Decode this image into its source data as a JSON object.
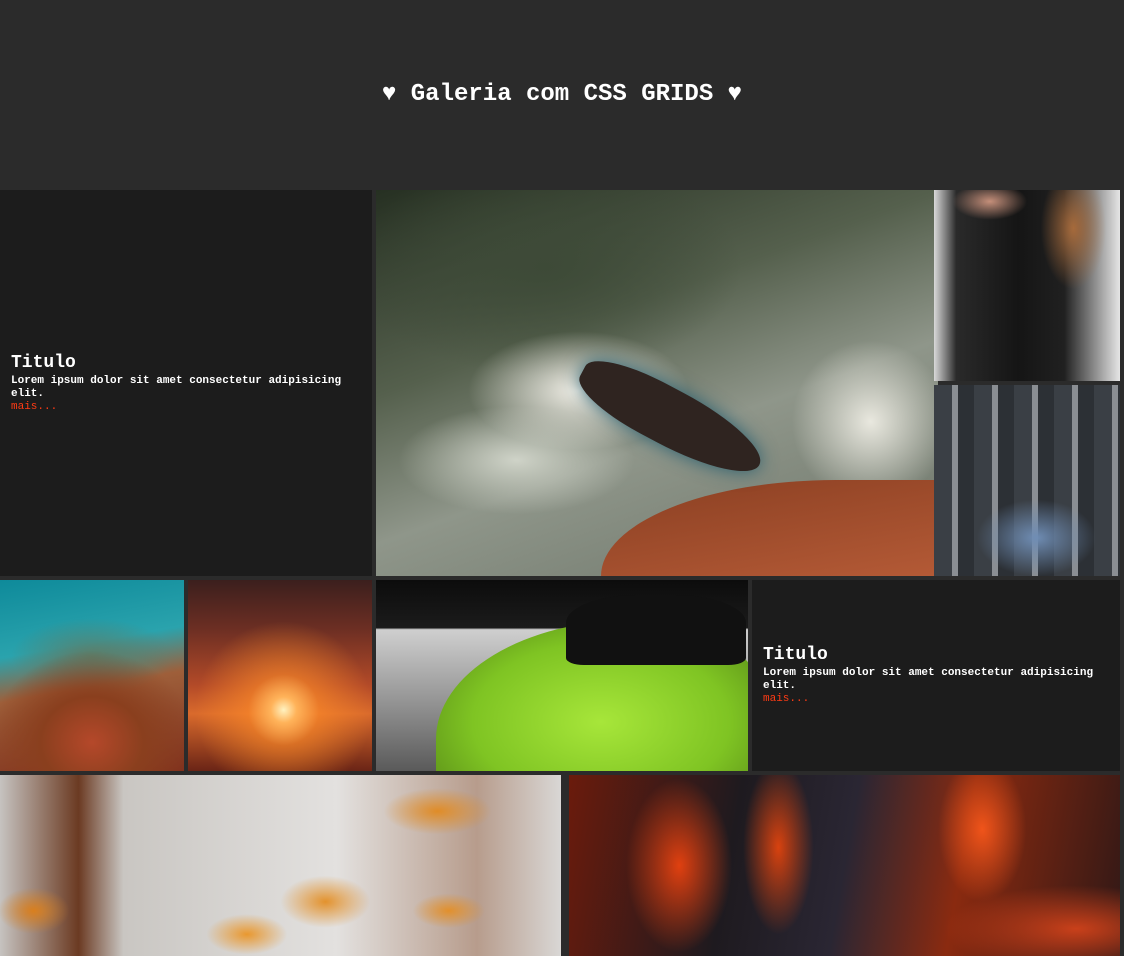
{
  "header": {
    "title": "♥ Galeria com CSS GRIDS ♥"
  },
  "gallery": {
    "text_card_1": {
      "title": "Titulo",
      "body": "Lorem ipsum dolor sit amet consectetur adipisicing elit.",
      "link": "mais..."
    },
    "text_card_2": {
      "title": "Titulo",
      "body": "Lorem ipsum dolor sit amet consectetur adipisicing elit.",
      "link": "mais..."
    },
    "link_color": "#ff3b14",
    "photos": [
      "ocean-shipwreck",
      "woman-jacket",
      "city-rooftop",
      "autumn-forest-road",
      "sunset-clouds",
      "green-sports-car",
      "autumn-leaves",
      "lava-flow"
    ]
  }
}
